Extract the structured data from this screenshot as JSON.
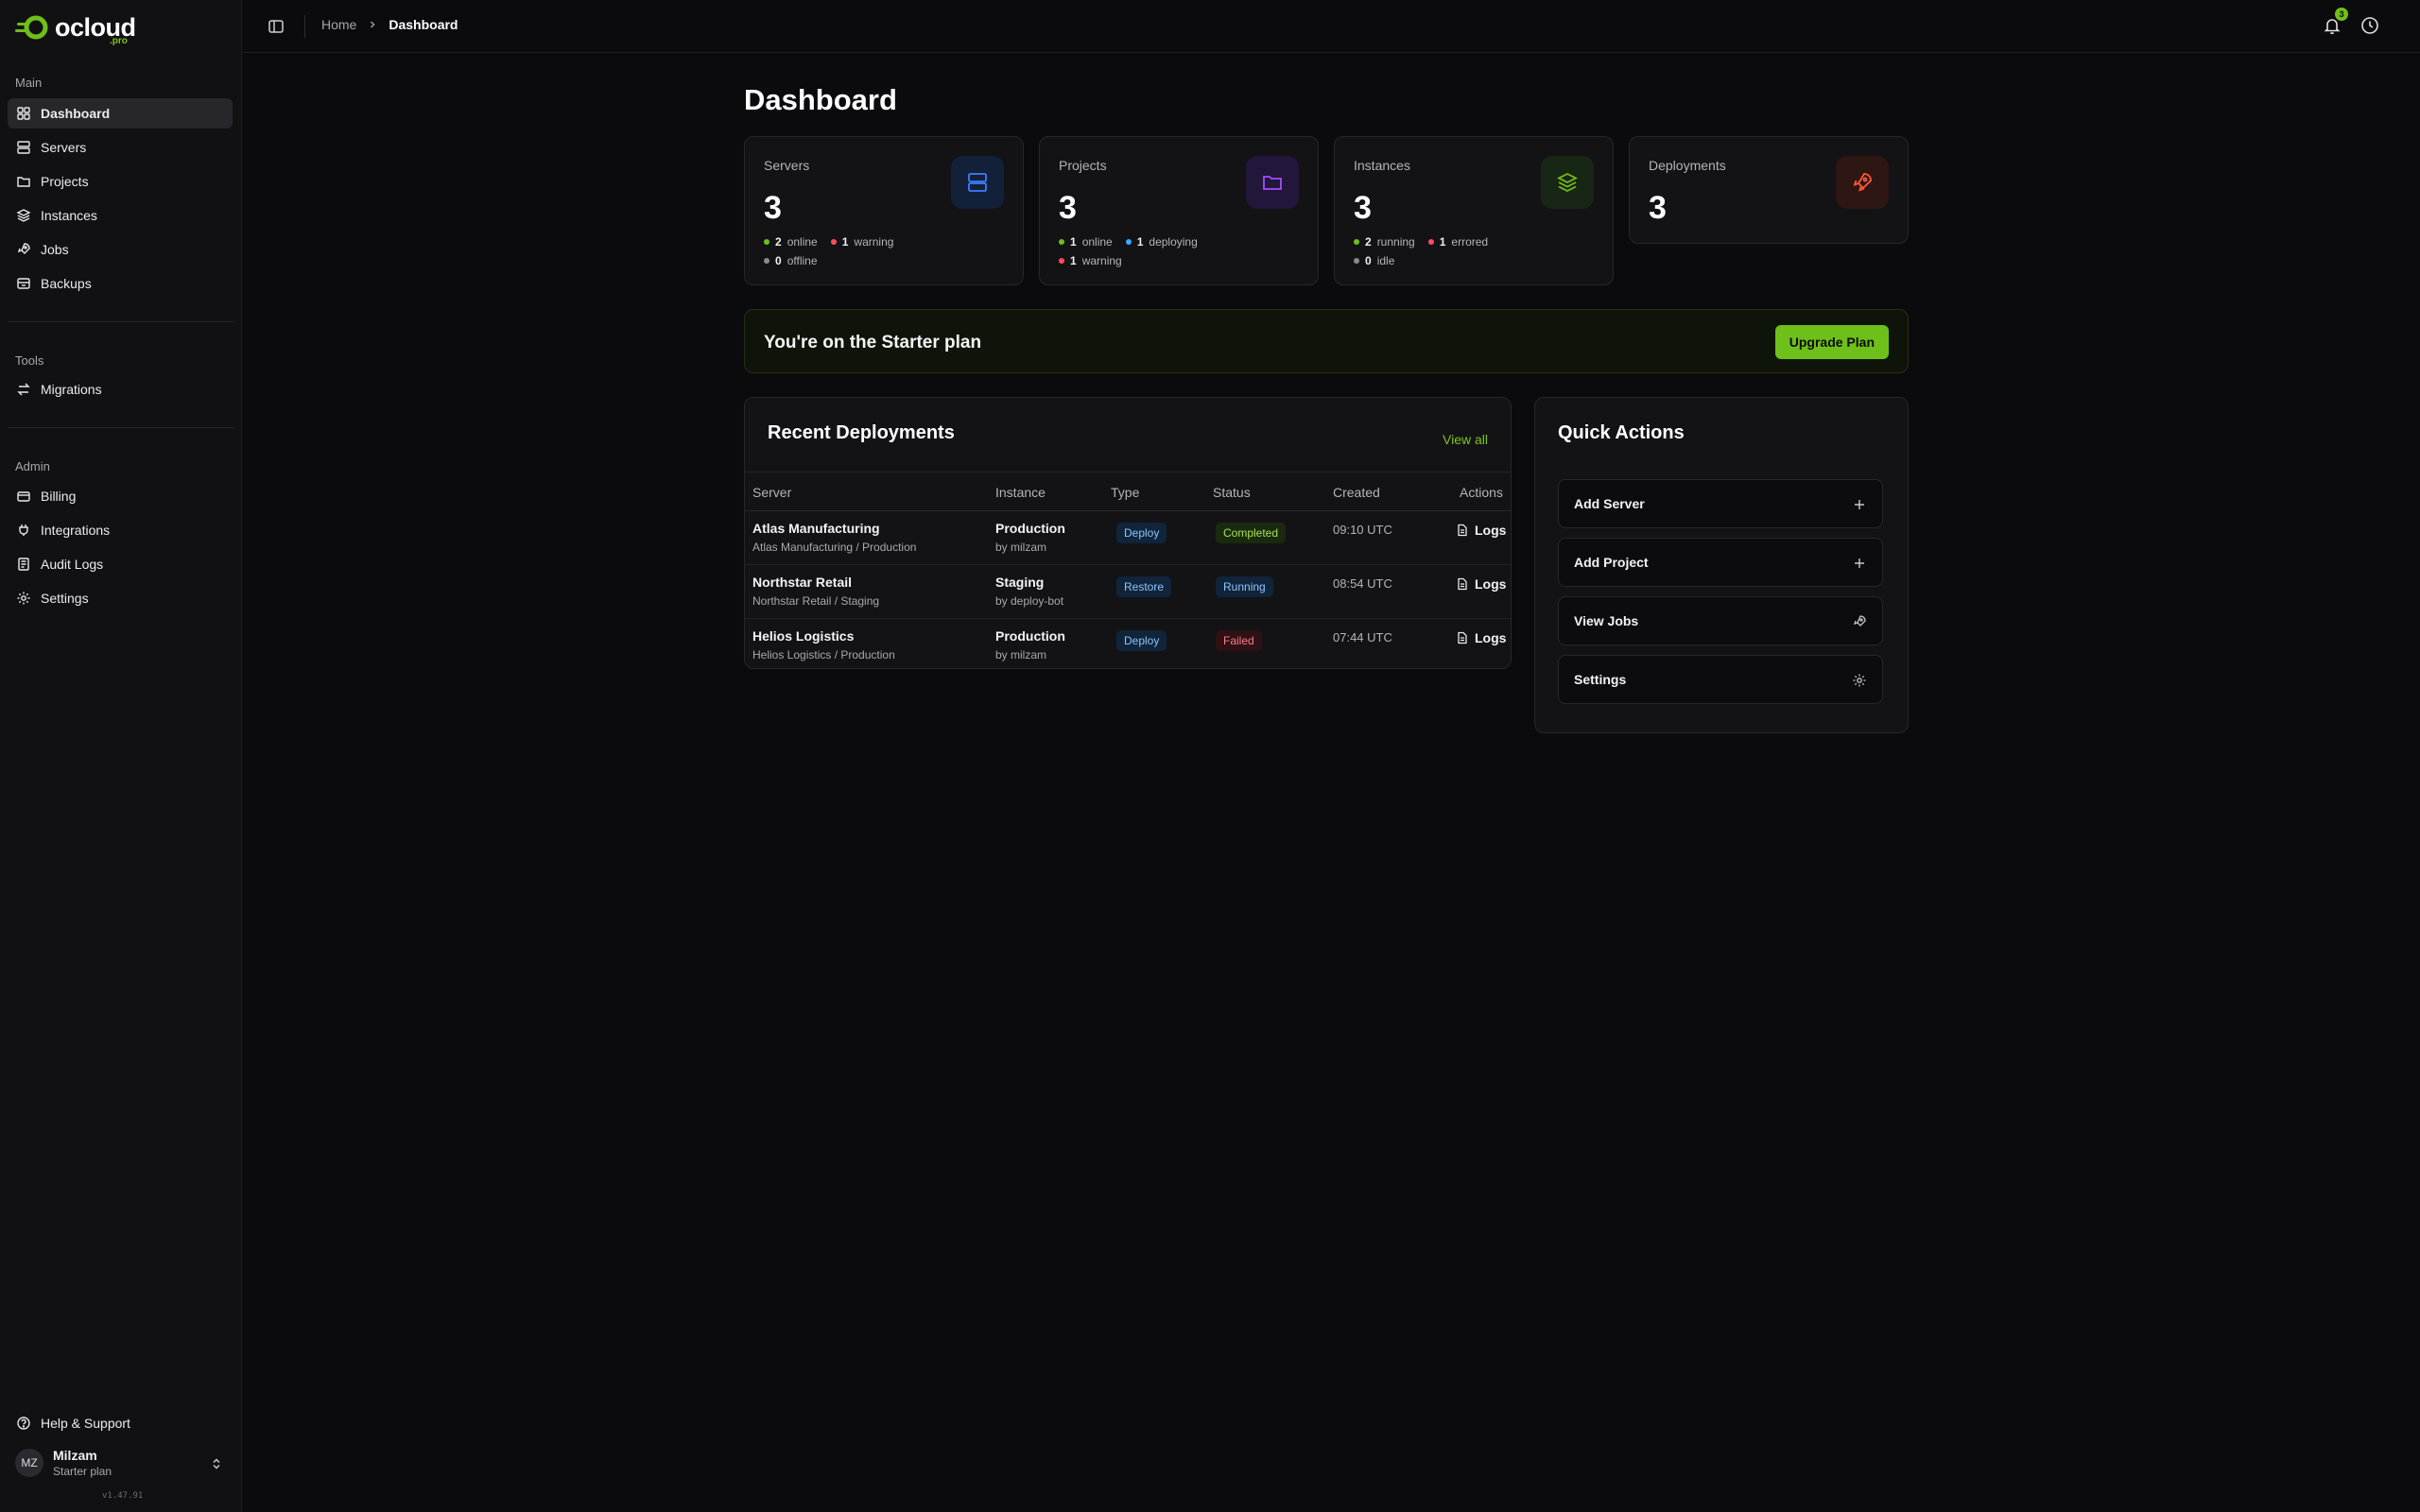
{
  "colors": {
    "accent": "#6fbf1a",
    "online": "#6fbf1a",
    "warning": "#ff4d5e",
    "offline": "#8a8a90",
    "deploying": "#38a8ff"
  },
  "brand": {
    "name": "ocloud",
    "suffix": ".pro"
  },
  "sidebar": {
    "main_label": "Main",
    "main_items": [
      {
        "label": "Dashboard",
        "icon": "grid-icon",
        "active": true
      },
      {
        "label": "Servers",
        "icon": "server-icon"
      },
      {
        "label": "Projects",
        "icon": "folder-icon"
      },
      {
        "label": "Instances",
        "icon": "layers-icon"
      },
      {
        "label": "Jobs",
        "icon": "rocket-icon"
      },
      {
        "label": "Backups",
        "icon": "database-icon"
      }
    ],
    "tools_label": "Tools",
    "tools_items": [
      {
        "label": "Migrations",
        "icon": "arrows-icon"
      }
    ],
    "admin_label": "Admin",
    "admin_items": [
      {
        "label": "Billing",
        "icon": "card-icon"
      },
      {
        "label": "Integrations",
        "icon": "plug-icon"
      },
      {
        "label": "Audit Logs",
        "icon": "log-icon"
      },
      {
        "label": "Settings",
        "icon": "gear-icon"
      }
    ],
    "help": "Help & Support",
    "user": {
      "initials": "MZ",
      "name": "Milzam",
      "plan": "Starter plan"
    },
    "version": "v1.47.91"
  },
  "topbar": {
    "breadcrumb_home": "Home",
    "breadcrumb_current": "Dashboard",
    "notification_count": "3"
  },
  "page_title": "Dashboard",
  "stats": [
    {
      "label": "Servers",
      "value": "3",
      "icon": "server-icon",
      "lines": [
        [
          {
            "n": "2",
            "t": "online",
            "c": "online"
          },
          {
            "n": "1",
            "t": "warning",
            "c": "warning"
          }
        ],
        [
          {
            "n": "0",
            "t": "offline",
            "c": "offline"
          }
        ]
      ]
    },
    {
      "label": "Projects",
      "value": "3",
      "icon": "folder-icon",
      "lines": [
        [
          {
            "n": "1",
            "t": "online",
            "c": "online"
          },
          {
            "n": "1",
            "t": "deploying",
            "c": "deploying"
          }
        ],
        [
          {
            "n": "1",
            "t": "warning",
            "c": "warning"
          }
        ]
      ]
    },
    {
      "label": "Instances",
      "value": "3",
      "icon": "layers-icon",
      "lines": [
        [
          {
            "n": "2",
            "t": "running",
            "c": "online"
          },
          {
            "n": "1",
            "t": "errored",
            "c": "warning"
          }
        ],
        [
          {
            "n": "0",
            "t": "idle",
            "c": "offline"
          }
        ]
      ]
    },
    {
      "label": "Deployments",
      "value": "3",
      "icon": "rocket-icon",
      "lines": []
    }
  ],
  "plan_banner": {
    "text": "You're on the Starter plan",
    "button": "Upgrade Plan"
  },
  "recent": {
    "title": "Recent Deployments",
    "view_all": "View all",
    "columns": [
      "Server",
      "Instance",
      "Type",
      "Status",
      "Created",
      "Actions"
    ],
    "rows": [
      {
        "server": "Atlas Manufacturing",
        "server_sub": "Atlas Manufacturing / Production",
        "instance": "Production",
        "by": "by milzam",
        "type": "Deploy",
        "status": "Completed",
        "status_kind": "green",
        "created": "09:10 UTC",
        "action": "Logs"
      },
      {
        "server": "Northstar Retail",
        "server_sub": "Northstar Retail / Staging",
        "instance": "Staging",
        "by": "by deploy-bot",
        "type": "Restore",
        "status": "Running",
        "status_kind": "blue",
        "created": "08:54 UTC",
        "action": "Logs"
      },
      {
        "server": "Helios Logistics",
        "server_sub": "Helios Logistics / Production",
        "instance": "Production",
        "by": "by milzam",
        "type": "Deploy",
        "status": "Failed",
        "status_kind": "red",
        "created": "07:44 UTC",
        "action": "Logs"
      }
    ]
  },
  "quick_actions": {
    "title": "Quick Actions",
    "items": [
      {
        "label": "Add Server",
        "icon": "plus-icon"
      },
      {
        "label": "Add Project",
        "icon": "plus-icon"
      },
      {
        "label": "View Jobs",
        "icon": "rocket-icon"
      },
      {
        "label": "Settings",
        "icon": "gear-icon"
      }
    ]
  }
}
